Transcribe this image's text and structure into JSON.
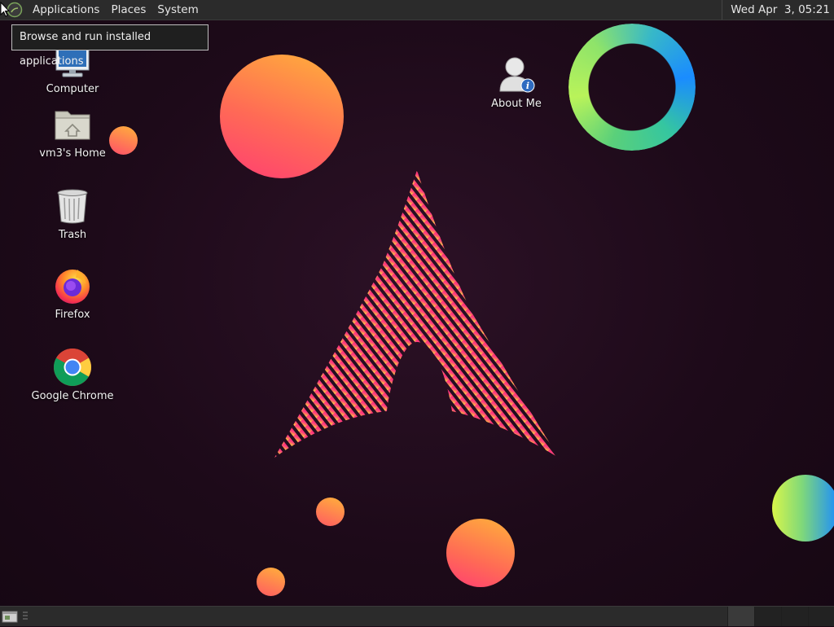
{
  "top_panel": {
    "menus": [
      "Applications",
      "Places",
      "System"
    ],
    "clock": "Wed Apr  3, 05:21"
  },
  "tooltip": {
    "text": "Browse and run installed applications"
  },
  "desktop_icons": {
    "computer": {
      "label": "Computer",
      "icon": "computer-icon"
    },
    "home": {
      "label": "vm3's Home",
      "icon": "home-folder-icon"
    },
    "trash": {
      "label": "Trash",
      "icon": "trash-icon"
    },
    "firefox": {
      "label": "Firefox",
      "icon": "firefox-icon"
    },
    "chrome": {
      "label": "Google Chrome",
      "icon": "chrome-icon"
    },
    "about_me": {
      "label": "About Me",
      "icon": "user-info-icon"
    }
  },
  "wallpaper": {
    "logo": "arch-linux-logo",
    "colors": {
      "orange": "#ffa63a",
      "pink": "#ff3e72",
      "green": "#b9f35a",
      "blue": "#1a8cff",
      "background": "#1d0a19"
    }
  },
  "bottom_panel": {
    "workspaces": 4,
    "active_workspace": 1
  }
}
